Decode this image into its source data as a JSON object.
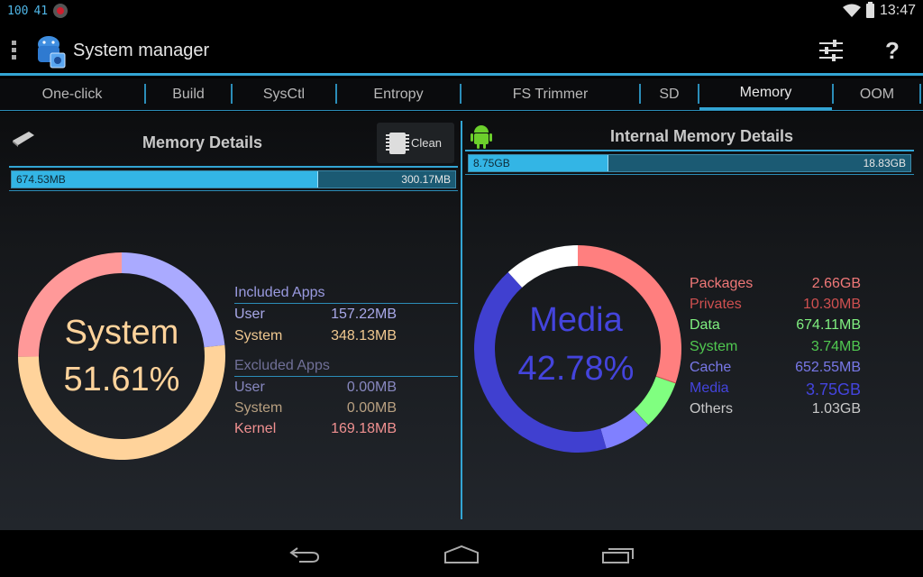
{
  "status_bar": {
    "indicators": [
      "100",
      "41"
    ],
    "time": "13:47",
    "icons": [
      "wifi-icon",
      "battery-icon"
    ]
  },
  "action_bar": {
    "title": "System manager",
    "actions": [
      "settings-sliders-icon",
      "help-icon"
    ],
    "help_label": "?"
  },
  "tabs": [
    {
      "label": "One-click",
      "active": false
    },
    {
      "label": "Build",
      "active": false
    },
    {
      "label": "SysCtl",
      "active": false
    },
    {
      "label": "Entropy",
      "active": false
    },
    {
      "label": "FS Trimmer",
      "active": false
    },
    {
      "label": "SD",
      "active": false
    },
    {
      "label": "Memory",
      "active": true
    },
    {
      "label": "OOM",
      "active": false
    }
  ],
  "memory_panel": {
    "title": "Memory Details",
    "clean_button": "Clean",
    "bar": {
      "used_label": "674.53MB",
      "free_label": "300.17MB",
      "used_fraction": 0.692
    },
    "donut": {
      "center_label": "System",
      "center_value": "51.61%",
      "center_color": "#ffd39b",
      "slices": [
        {
          "name": "User",
          "value": 157.22,
          "color": "#aaaaff"
        },
        {
          "name": "System",
          "value": 348.13,
          "color": "#ffd39b"
        },
        {
          "name": "Kernel",
          "value": 169.18,
          "color": "#ff9999"
        }
      ]
    },
    "included_header": "Included Apps",
    "included": [
      {
        "label": "User",
        "value": "157.22MB",
        "color": "#a8a8e8"
      },
      {
        "label": "System",
        "value": "348.13MB",
        "color": "#f0c890"
      }
    ],
    "excluded_header": "Excluded Apps",
    "excluded": [
      {
        "label": "User",
        "value": "0.00MB",
        "color": "#8888c0"
      },
      {
        "label": "System",
        "value": "0.00MB",
        "color": "#b8a080"
      },
      {
        "label": "Kernel",
        "value": "169.18MB",
        "color": "#f09090"
      }
    ]
  },
  "internal_panel": {
    "title": "Internal Memory Details",
    "bar": {
      "used_label": "8.75GB",
      "free_label": "18.83GB",
      "used_fraction": 0.317
    },
    "donut": {
      "center_label": "Media",
      "center_value": "42.78%",
      "center_color": "#4444dd",
      "slices": [
        {
          "name": "Packages",
          "value": 2.66,
          "color": "#ff7f7f"
        },
        {
          "name": "Privates",
          "value": 0.0103,
          "color": "#e05050"
        },
        {
          "name": "Data",
          "value": 0.674,
          "color": "#80ff80"
        },
        {
          "name": "System",
          "value": 0.00374,
          "color": "#40c040"
        },
        {
          "name": "Cache",
          "value": 0.652,
          "color": "#8080ff"
        },
        {
          "name": "Media",
          "value": 3.75,
          "color": "#4040d0"
        },
        {
          "name": "Others",
          "value": 1.03,
          "color": "#ffffff"
        }
      ]
    },
    "legend": [
      {
        "label": "Packages",
        "value": "2.66GB",
        "color": "#f07878"
      },
      {
        "label": "Privates",
        "value": "10.30MB",
        "color": "#d05050"
      },
      {
        "label": "Data",
        "value": "674.11MB",
        "color": "#80f080"
      },
      {
        "label": "System",
        "value": "3.74MB",
        "color": "#50c850"
      },
      {
        "label": "Cache",
        "value": "652.55MB",
        "color": "#7878e8"
      },
      {
        "label": "Media",
        "value": "3.75GB",
        "color": "#4444dd"
      },
      {
        "label": "Others",
        "value": "1.03GB",
        "color": "#c8c8c8"
      }
    ]
  },
  "nav_bar": {
    "buttons": [
      "back-icon",
      "home-icon",
      "recents-icon"
    ]
  }
}
